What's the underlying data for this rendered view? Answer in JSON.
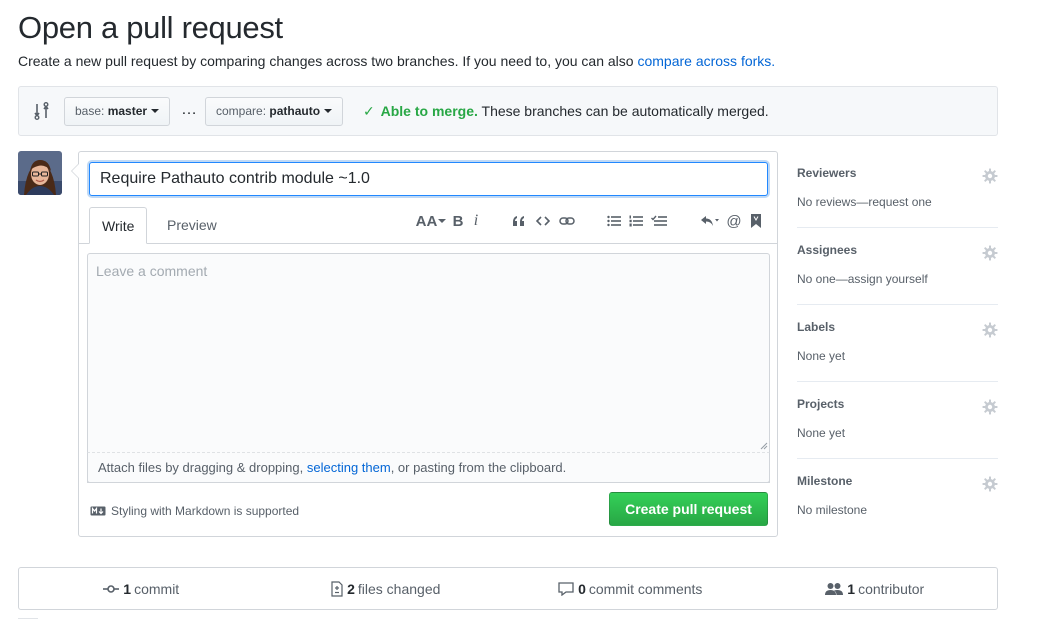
{
  "header": {
    "title": "Open a pull request",
    "subtitle": "Create a new pull request by comparing changes across two branches. If you need to, you can also ",
    "subtitle_link": "compare across forks."
  },
  "range": {
    "base_prefix": "base:",
    "base_value": "master",
    "separator": "…",
    "compare_prefix": "compare:",
    "compare_value": "pathauto",
    "merge_check": "✓",
    "merge_ok": "Able to merge.",
    "merge_text": " These branches can be automatically merged."
  },
  "composer": {
    "title_value": "Require Pathauto contrib module ~1.0",
    "tabs": [
      "Write",
      "Preview"
    ],
    "comment_placeholder": "Leave a comment",
    "attach_pre": "Attach files by dragging & dropping, ",
    "attach_link": "selecting them",
    "attach_post": ", or pasting from the clipboard.",
    "markdown_note": "Styling with Markdown is supported",
    "submit_label": "Create pull request",
    "toolbar_icons": [
      "text-size-icon",
      "bold-icon",
      "italic-icon",
      "quote-icon",
      "code-icon",
      "link-icon",
      "unordered-list-icon",
      "ordered-list-icon",
      "task-list-icon",
      "reply-icon",
      "mention-icon",
      "bookmark-icon"
    ],
    "toolbar_text": {
      "aa": "AA",
      "bold": "B",
      "italic": "i",
      "mention": "@"
    }
  },
  "sidebar": {
    "sections": [
      {
        "heading": "Reviewers",
        "value": "No reviews—request one"
      },
      {
        "heading": "Assignees",
        "value": "No one—assign yourself"
      },
      {
        "heading": "Labels",
        "value": "None yet"
      },
      {
        "heading": "Projects",
        "value": "None yet"
      },
      {
        "heading": "Milestone",
        "value": "No milestone"
      }
    ]
  },
  "stats": {
    "commits_count": "1",
    "commits_label": "commit",
    "files_count": "2",
    "files_label": "files changed",
    "comments_count": "0",
    "comments_label": "commit comments",
    "contributors_count": "1",
    "contributors_label": "contributor"
  },
  "colors": {
    "accent_blue": "#0366d6",
    "merge_green": "#28a745",
    "button_green": "#2cbe4e"
  }
}
